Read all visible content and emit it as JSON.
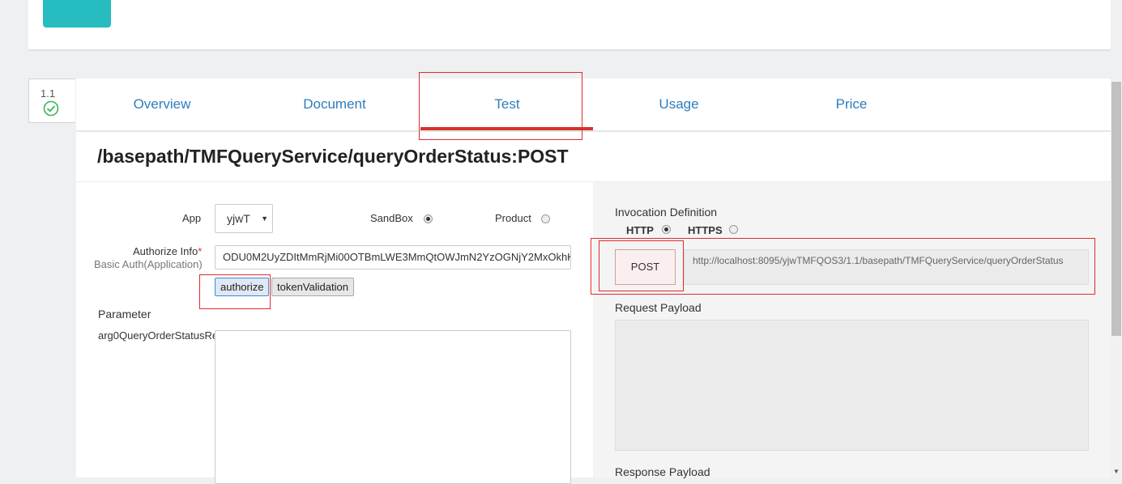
{
  "version": "1.1",
  "tabs": [
    {
      "label": "Overview"
    },
    {
      "label": "Document"
    },
    {
      "label": "Test"
    },
    {
      "label": "Usage"
    },
    {
      "label": "Price"
    }
  ],
  "path_title": "/basepath/TMFQueryService/queryOrderStatus:POST",
  "form": {
    "app_label": "App",
    "app_value": "yjwT",
    "env_sandbox_label": "SandBox",
    "env_product_label": "Product",
    "auth_label": "Authorize Info",
    "auth_required": "*",
    "auth_sublabel": "Basic Auth(Application)",
    "auth_value": "ODU0M2UyZDItMmRjMi00OTBmLWE3MmQtOWJmN2YzOGNjY2MxOkhK",
    "authorize_button": "authorize",
    "token_button": "tokenValidation",
    "parameter_heading": "Parameter",
    "param_name": "arg0QueryOrderStatusRe"
  },
  "invocation": {
    "heading": "Invocation Definition",
    "http_label": "HTTP",
    "https_label": "HTTPS",
    "method": "POST",
    "url": "http://localhost:8095/yjwTMFQOS3/1.1/basepath/TMFQueryService/queryOrderStatus",
    "request_payload_label": "Request Payload",
    "response_payload_label": "Response Payload"
  }
}
